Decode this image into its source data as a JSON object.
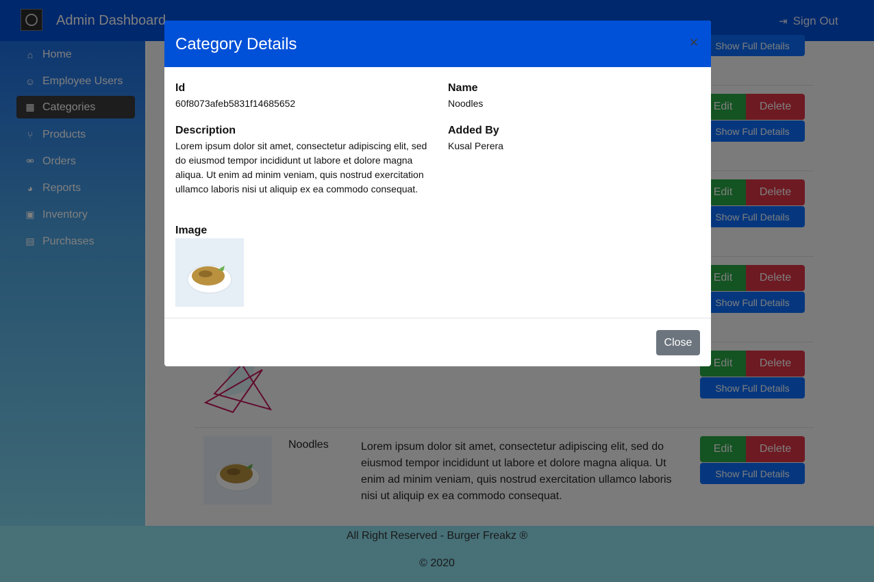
{
  "header": {
    "title": "Admin Dashboard",
    "sign_out_label": "Sign Out"
  },
  "sidebar": {
    "items": [
      {
        "label": "Home",
        "icon": "home-icon"
      },
      {
        "label": "Employee Users",
        "icon": "user-icon"
      },
      {
        "label": "Categories",
        "icon": "cubes-icon",
        "active": true
      },
      {
        "label": "Products",
        "icon": "cutlery-icon"
      },
      {
        "label": "Orders",
        "icon": "motorcycle-icon"
      },
      {
        "label": "Reports",
        "icon": "pie-chart-icon"
      },
      {
        "label": "Inventory",
        "icon": "briefcase-icon"
      },
      {
        "label": "Purchases",
        "icon": "money-icon"
      }
    ]
  },
  "table": {
    "edit_label": "Edit",
    "delete_label": "Delete",
    "show_details_label": "Show Full Details",
    "last_row": {
      "name": "Noodles",
      "description": "Lorem ipsum dolor sit amet, consectetur adipiscing elit, sed do eiusmod tempor incididunt ut labore et dolore magna aliqua. Ut enim ad minim veniam, quis nostrud exercitation ullamco laboris nisi ut aliquip ex ea commodo consequat."
    }
  },
  "modal": {
    "title": "Category Details",
    "close_x": "×",
    "id_label": "Id",
    "id_value": "60f8073afeb5831f14685652",
    "name_label": "Name",
    "name_value": "Noodles",
    "description_label": "Description",
    "description_value": "Lorem ipsum dolor sit amet, consectetur adipiscing elit, sed do eiusmod tempor incididunt ut labore et dolore magna aliqua. Ut enim ad minim veniam, quis nostrud exercitation ullamco laboris nisi ut aliquip ex ea commodo consequat.",
    "added_by_label": "Added By",
    "added_by_value": "Kusal Perera",
    "image_label": "Image",
    "close_button_label": "Close"
  },
  "footer": {
    "rights": "All Right Reserved - Burger Freakz ®",
    "copyright": "© 2020"
  },
  "colors": {
    "primary": "#0050d8",
    "success": "#28a745",
    "danger": "#dc3545",
    "secondary": "#6c757d"
  }
}
